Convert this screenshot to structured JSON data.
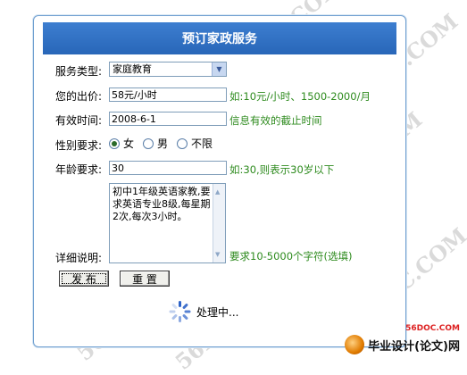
{
  "form": {
    "title": "预订家政服务",
    "service_type": {
      "label": "服务类型:",
      "value": "家庭教育"
    },
    "price": {
      "label": "您的出价:",
      "value": "58元/小时",
      "hint": "如:10元/小时、1500-2000/月"
    },
    "valid_time": {
      "label": "有效时间:",
      "value": "2008-6-1",
      "hint": "信息有效的截止时间"
    },
    "gender": {
      "label": "性别要求:",
      "options": [
        "女",
        "男",
        "不限"
      ],
      "selected": "女"
    },
    "age": {
      "label": "年龄要求:",
      "value": "30",
      "hint": "如:30,则表示30岁以下"
    },
    "details": {
      "label": "详细说明:",
      "value": "初中1年级英语家教,要求英语专业8级,每星期2次,每次3小时。",
      "hint": "要求10-5000个字符(选填)"
    },
    "submit_label": "发 布",
    "reset_label": "重 置",
    "loading_text": "处理中..."
  },
  "watermark": {
    "text": "56DOC.COM",
    "color": "#969696"
  },
  "logo": {
    "site": "56DOC.COM",
    "text": "毕业设计(论文)网"
  },
  "colors": {
    "title_bar": "#2f70c4",
    "hint": "#2e8b1e",
    "border": "#6f9fd0"
  }
}
